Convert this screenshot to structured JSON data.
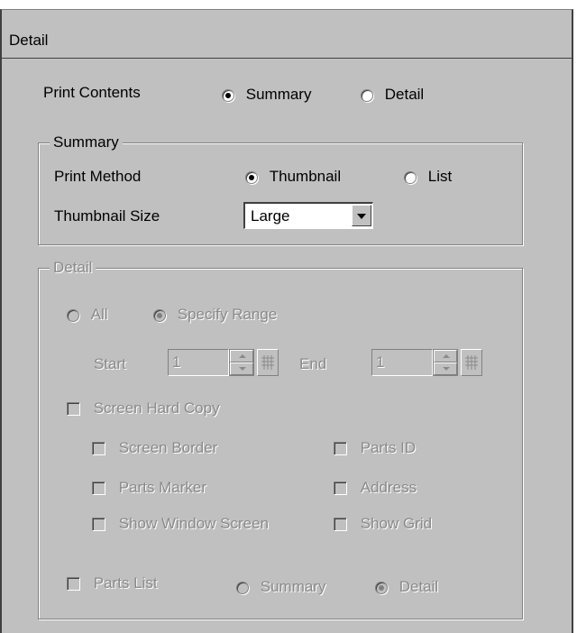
{
  "panel": {
    "title": "Detail"
  },
  "print_contents": {
    "label": "Print Contents",
    "options": [
      {
        "label": "Summary",
        "selected": true
      },
      {
        "label": "Detail",
        "selected": false
      }
    ]
  },
  "summary_group": {
    "legend": "Summary",
    "print_method": {
      "label": "Print Method",
      "options": [
        {
          "label": "Thumbnail",
          "selected": true
        },
        {
          "label": "List",
          "selected": false
        }
      ]
    },
    "thumbnail_size": {
      "label": "Thumbnail Size",
      "value": "Large"
    }
  },
  "detail_group": {
    "legend": "Detail",
    "enabled": false,
    "range_options": [
      {
        "label": "All",
        "selected": false
      },
      {
        "label": "Specify Range",
        "selected": true
      }
    ],
    "start": {
      "label": "Start",
      "value": "1"
    },
    "end": {
      "label": "End",
      "value": "1"
    },
    "screen_hard_copy": {
      "label": "Screen Hard Copy",
      "checked": false
    },
    "screen_border": {
      "label": "Screen Border",
      "checked": false
    },
    "parts_id": {
      "label": "Parts ID",
      "checked": false
    },
    "parts_marker": {
      "label": "Parts Marker",
      "checked": false
    },
    "address": {
      "label": "Address",
      "checked": false
    },
    "show_window_screen": {
      "label": "Show Window Screen",
      "checked": false
    },
    "show_grid": {
      "label": "Show Grid",
      "checked": false
    },
    "parts_list": {
      "label": "Parts List",
      "checked": false,
      "options": [
        {
          "label": "Summary",
          "selected": false
        },
        {
          "label": "Detail",
          "selected": true
        }
      ]
    }
  },
  "icons": {
    "spin": "spin-up-down-icon",
    "keypad": "keypad-grid-icon",
    "dropdown": "chevron-down-icon"
  },
  "colors": {
    "face": "#c0c0c0",
    "disabled_text": "#8a8a8a",
    "shadow": "#808080",
    "dark_shadow": "#404040",
    "highlight": "#ffffff"
  }
}
